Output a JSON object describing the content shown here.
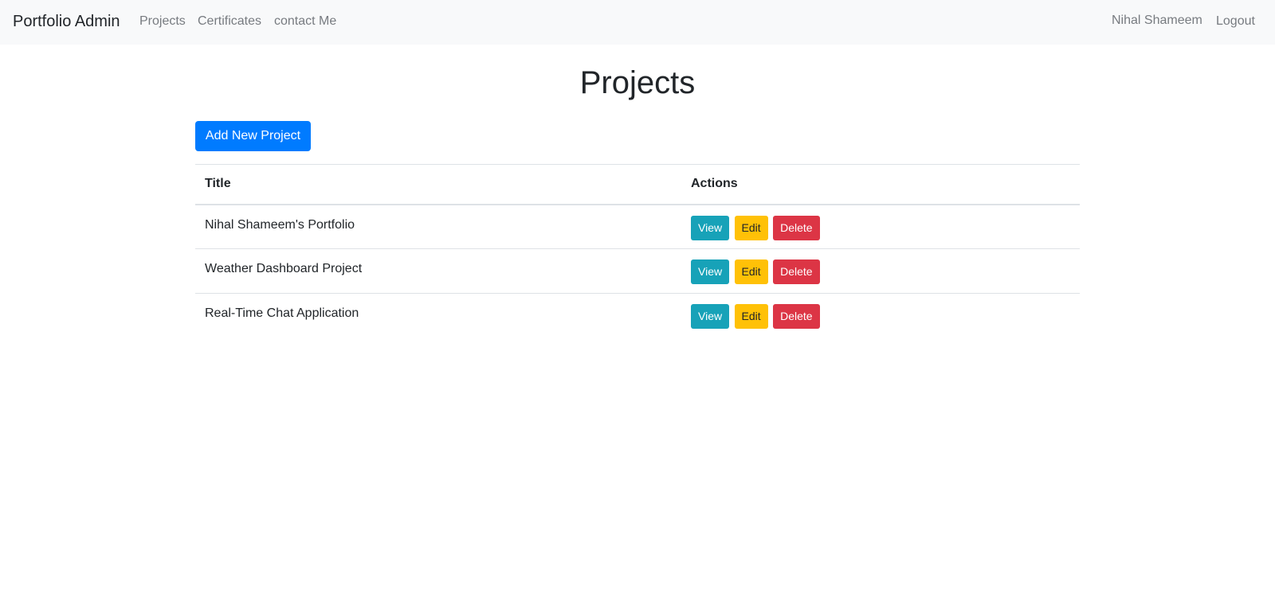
{
  "navbar": {
    "brand": "Portfolio Admin",
    "links": [
      "Projects",
      "Certificates",
      "contact Me"
    ],
    "user": "Nihal Shameem",
    "logout": "Logout"
  },
  "main": {
    "title": "Projects",
    "add_button": "Add New Project",
    "table": {
      "headers": [
        "Title",
        "Actions"
      ],
      "rows": [
        {
          "title": "Nihal Shameem's Portfolio"
        },
        {
          "title": "Weather Dashboard Project"
        },
        {
          "title": "Real-Time Chat Application"
        }
      ],
      "actions": {
        "view": "View",
        "edit": "Edit",
        "delete": "Delete"
      }
    }
  },
  "colors": {
    "primary": "#007bff",
    "info": "#17a2b8",
    "warning": "#ffc107",
    "danger": "#dc3545",
    "navbar_bg": "#f8f9fa"
  }
}
